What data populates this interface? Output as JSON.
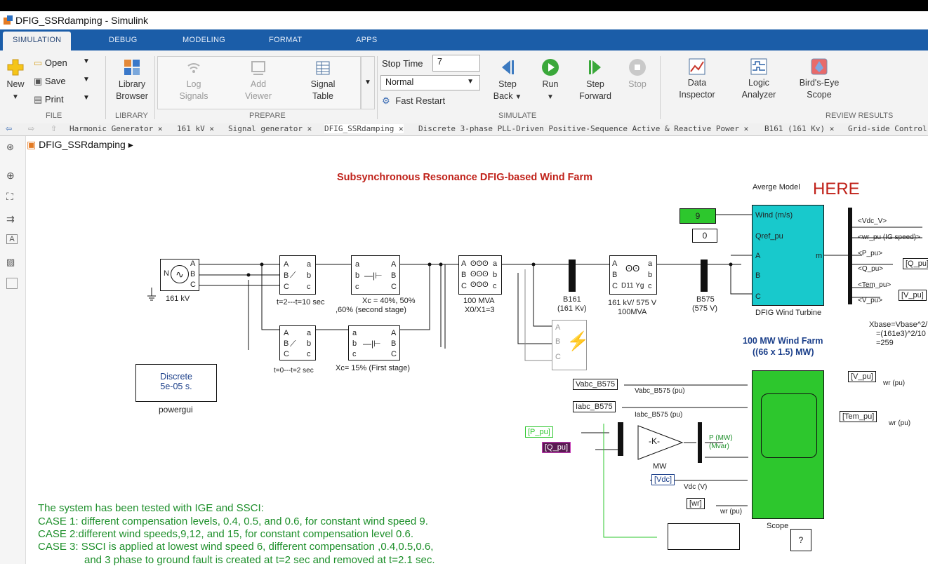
{
  "window": {
    "title": "DFIG_SSRdamping - Simulink"
  },
  "ribbon_tabs": [
    "SIMULATION",
    "DEBUG",
    "MODELING",
    "FORMAT",
    "APPS"
  ],
  "file": {
    "new": "New",
    "open": "Open",
    "save": "Save",
    "print": "Print",
    "group": "FILE"
  },
  "library": {
    "browser": "Library Browser",
    "group": "LIBRARY"
  },
  "prepare": {
    "log_signals": "Log Signals",
    "add_viewer": "Add Viewer",
    "signal_table": "Signal Table",
    "group": "PREPARE"
  },
  "simulate": {
    "stop_time_label": "Stop Time",
    "stop_time_value": "7",
    "mode": "Normal",
    "fast_restart": "Fast Restart",
    "step_back": "Step Back",
    "run": "Run",
    "step_forward": "Step Forward",
    "stop": "Stop",
    "group": "SIMULATE"
  },
  "review": {
    "data_inspector": "Data Inspector",
    "logic_analyzer": "Logic Analyzer",
    "birds_eye": "Bird's-Eye Scope",
    "group": "REVIEW RESULTS"
  },
  "doc_tabs": [
    "Harmonic Generator",
    "161 kV",
    "Signal generator",
    "DFIG_SSRdamping",
    "Discrete 3-phase PLL-Driven  Positive-Sequence Active & Reactive Power",
    "B161 (161 Kv)",
    "Grid-side Control"
  ],
  "breadcrumb": "DFIG_SSRdamping",
  "diagram": {
    "title": "Subsynchronous Resonance DFIG-based Wind Farm",
    "avg_model": "Averge Model",
    "here": "HERE",
    "source_label": "161 kV",
    "brk1_label": "t=2---t=10 sec",
    "brk2_label": "t=0---t=2 sec",
    "cap1_label1": "Xc = 40%, 50%",
    "cap1_label2": ",60%   (second stage)",
    "cap2_label": "Xc= 15%  (First stage)",
    "tx1_label1": "100 MVA",
    "tx1_label2": "X0/X1=3",
    "b161_label1": "B161",
    "b161_label2": "(161 Kv)",
    "tx2_label1": "161 kV/ 575 V",
    "tx2_label2": "100MVA",
    "b575_label1": "B575",
    "b575_label2": "(575 V)",
    "wind_const": "9",
    "qref_const": "0",
    "dfig_ports": [
      "Wind (m/s)",
      "Qref_pu",
      "A",
      "B",
      "C"
    ],
    "dfig_out": "m",
    "dfig_label": "DFIG Wind Turbine",
    "bus_signals": [
      "<Vdc_V>",
      "<wr_pu (IG speed)>",
      "<P_pu>",
      "<Q_pu>",
      "<Tem_pu>",
      "<V_pu>"
    ],
    "goto_q": "[Q_pu]",
    "goto_v": "[V_pu]",
    "xbase_lines": [
      "Xbase=Vbase^2/",
      "=(161e3)^2/10",
      "=259"
    ],
    "farm_title1": "100 MW Wind Farm",
    "farm_title2": "((66 x 1.5) MW)",
    "powergui_lines": [
      "Discrete",
      "5e-05 s."
    ],
    "powergui_label": "powergui",
    "vabc_tag": "Vabc_B575",
    "iabc_tag": "Iabc_B575",
    "vabc_sig": "Vabc_B575 (pu)",
    "iabc_sig": "Iabc_B575 (pu)",
    "p_tag": "[P_pu]",
    "q_tag": "[Q_pu]",
    "gain": "-K-",
    "gain_label": "MW",
    "pq_sig1": "P (MW)",
    "pq_sig2": "(Mvar)",
    "vdc_tag": "[Vdc]",
    "vdc_sig": "Vdc (V)",
    "wr_tag": "[wr]",
    "wr_sig": "wr (pu)",
    "scope_label": "Scope",
    "help": "?",
    "from_v": "[V_pu]",
    "from_tem": "[Tem_pu]",
    "wr_pu1": "wr (pu)",
    "wr_pu2": "wr (pu)",
    "notes": [
      "The system has been tested with IGE and SSCI:",
      "CASE 1: different compensation levels, 0.4, 0.5, and 0.6, for constant wind speed 9.",
      "CASE 2:different wind speeds,9,12, and 15, for constant compensation level 0.6.",
      "CASE 3: SSCI is applied at lowest wind speed 6, different compensation ,0.4,0.5,0.6,",
      "and 3 phase to ground fault is created at t=2 sec and removed at t=2.1 sec."
    ]
  },
  "colors": {
    "ribbon_blue": "#1b5da8",
    "title_red": "#c0221a",
    "note_green": "#1d8f2a",
    "dfig_cyan": "#18c9cc",
    "scope_green": "#2dc72d"
  }
}
